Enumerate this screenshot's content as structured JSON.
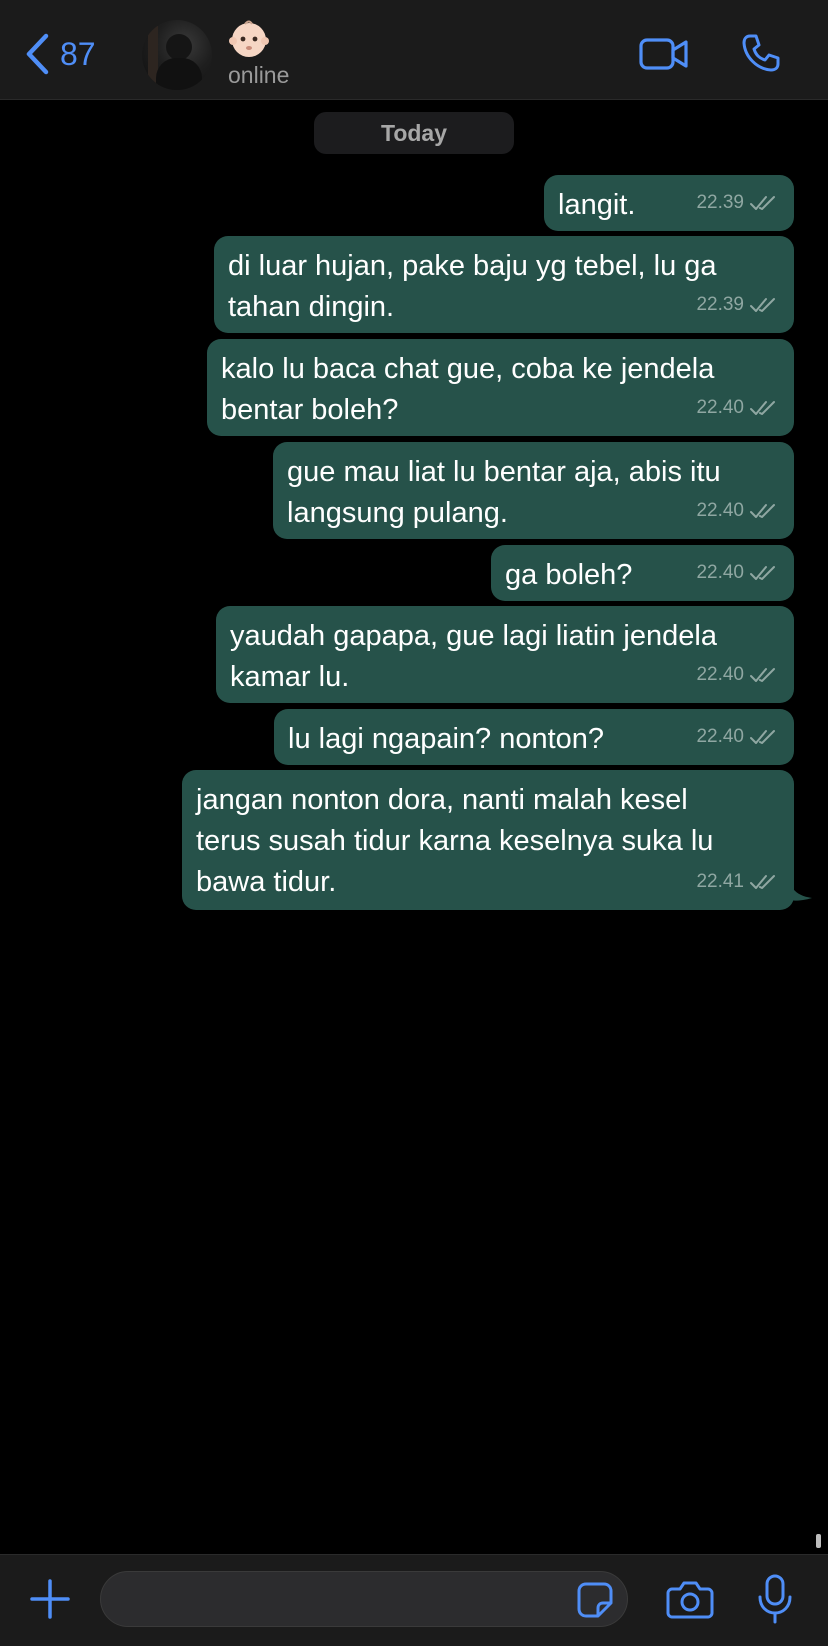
{
  "header": {
    "back_count": "87",
    "contact_emoji": "baby-face-emoji",
    "status": "online",
    "icons": [
      "chevron-left-icon",
      "video-call-icon",
      "phone-icon"
    ]
  },
  "date_label": "Today",
  "messages": [
    {
      "text": "langit.",
      "time": "22.39"
    },
    {
      "text": "di luar hujan, pake baju yg tebel, lu ga\ntahan dingin.",
      "time": "22.39"
    },
    {
      "text": "kalo lu baca chat gue, coba ke jendela\nbentar boleh?",
      "time": "22.40"
    },
    {
      "text": "gue mau liat lu bentar aja, abis itu\nlangsung pulang.",
      "time": "22.40"
    },
    {
      "text": "ga boleh?",
      "time": "22.40"
    },
    {
      "text": "yaudah gapapa, gue lagi liatin jendela\nkamar lu.",
      "time": "22.40"
    },
    {
      "text": "lu lagi ngapain? nonton?",
      "time": "22.40"
    },
    {
      "text": "jangan nonton dora, nanti malah kesel\nterus susah tidur karna keselnya suka lu\nbawa tidur.",
      "time": "22.41"
    }
  ],
  "composer": {
    "input_value": "",
    "icons": [
      "plus-icon",
      "sticker-icon",
      "camera-icon",
      "microphone-icon"
    ]
  },
  "colors": {
    "accent": "#4f8ef7",
    "bubble_outgoing": "#26524a",
    "background": "#000000",
    "bar": "#1b1b1b"
  }
}
